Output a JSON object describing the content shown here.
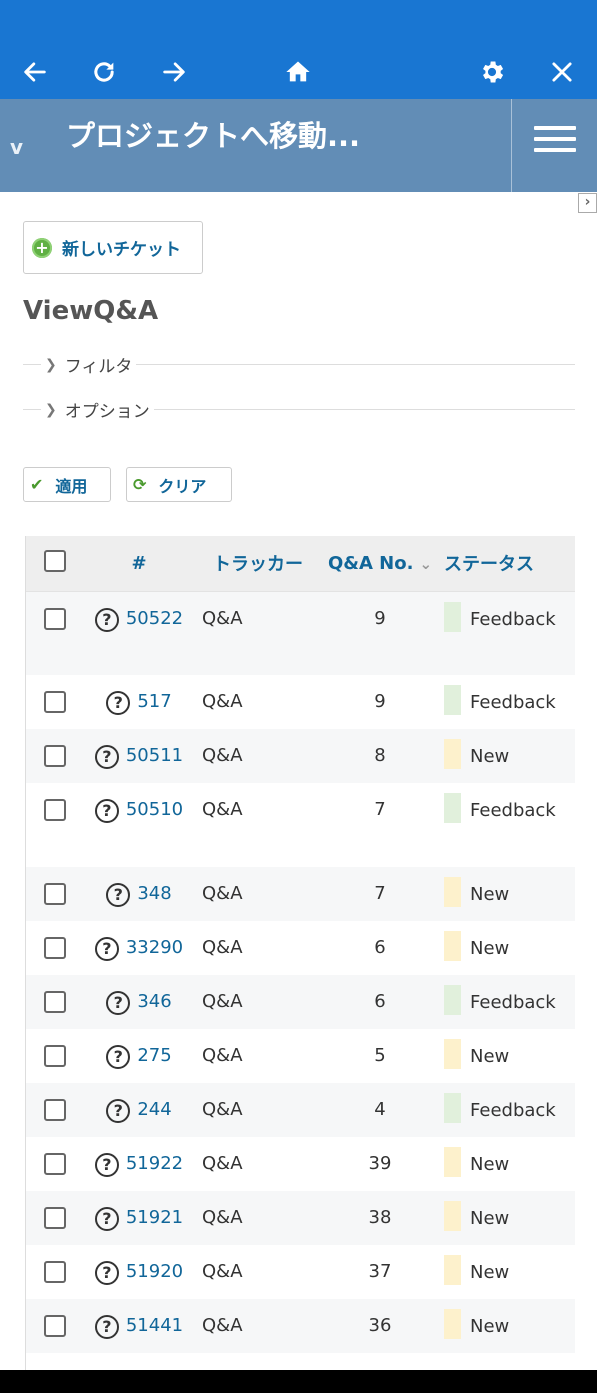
{
  "browser": {
    "buttons": [
      {
        "name": "back-icon"
      },
      {
        "name": "reload-icon"
      },
      {
        "name": "forward-icon"
      },
      {
        "name": "home-icon"
      },
      {
        "name": "gear-icon"
      },
      {
        "name": "close-icon"
      }
    ]
  },
  "header": {
    "project_chevron": "v",
    "project_jump": "プロジェクトへ移動..."
  },
  "sidebar_toggle": "›",
  "actions": {
    "new_ticket": "新しいチケット"
  },
  "page": {
    "title": "ViewQ&A"
  },
  "filters": {
    "filter_label": "フィルタ",
    "options_label": "オプション"
  },
  "buttons": {
    "apply": "適用",
    "clear": "クリア"
  },
  "table": {
    "columns": [
      "#",
      "トラッカー",
      "Q&A No.",
      "ステータス"
    ],
    "sort_indicator": "⌄",
    "status_colors": {
      "Feedback": "#e1f0dc",
      "New": "#fdf1cc"
    },
    "rows": [
      {
        "id": "50522",
        "tracker": "Q&A",
        "qa_no": "9",
        "status": "Feedback"
      },
      {
        "id": "517",
        "tracker": "Q&A",
        "qa_no": "9",
        "status": "Feedback"
      },
      {
        "id": "50511",
        "tracker": "Q&A",
        "qa_no": "8",
        "status": "New"
      },
      {
        "id": "50510",
        "tracker": "Q&A",
        "qa_no": "7",
        "status": "Feedback"
      },
      {
        "id": "348",
        "tracker": "Q&A",
        "qa_no": "7",
        "status": "New"
      },
      {
        "id": "33290",
        "tracker": "Q&A",
        "qa_no": "6",
        "status": "New"
      },
      {
        "id": "346",
        "tracker": "Q&A",
        "qa_no": "6",
        "status": "Feedback"
      },
      {
        "id": "275",
        "tracker": "Q&A",
        "qa_no": "5",
        "status": "New"
      },
      {
        "id": "244",
        "tracker": "Q&A",
        "qa_no": "4",
        "status": "Feedback"
      },
      {
        "id": "51922",
        "tracker": "Q&A",
        "qa_no": "39",
        "status": "New"
      },
      {
        "id": "51921",
        "tracker": "Q&A",
        "qa_no": "38",
        "status": "New"
      },
      {
        "id": "51920",
        "tracker": "Q&A",
        "qa_no": "37",
        "status": "New"
      },
      {
        "id": "51441",
        "tracker": "Q&A",
        "qa_no": "36",
        "status": "New"
      }
    ]
  }
}
